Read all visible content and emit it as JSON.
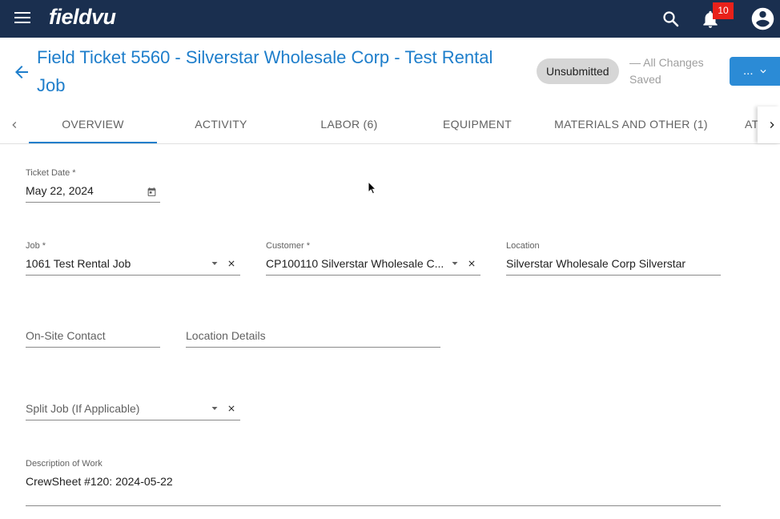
{
  "topbar": {
    "brand": "fieldvu",
    "notification_count": "10",
    "icons": [
      "menu-icon",
      "search-icon",
      "bell-icon",
      "account-circle-icon"
    ],
    "background_color": "#1a2f4f",
    "badge_color": "#e8211a"
  },
  "header": {
    "title": "Field Ticket 5560 - Silverstar Wholesale Corp - Test Rental Job",
    "status": "Unsubmitted",
    "save_state": "— All Changes Saved",
    "more_label": "...",
    "accent_color": "#1e7ecb"
  },
  "tabs": [
    {
      "label": "OVERVIEW",
      "active": true
    },
    {
      "label": "ACTIVITY",
      "active": false
    },
    {
      "label": "LABOR (6)",
      "active": false
    },
    {
      "label": "EQUIPMENT",
      "active": false
    },
    {
      "label": "MATERIALS AND OTHER (1)",
      "active": false
    },
    {
      "label": "AT",
      "active": false
    }
  ],
  "form": {
    "ticket_date": {
      "label": "Ticket Date *",
      "value": "May 22, 2024"
    },
    "job": {
      "label": "Job *",
      "value": "1061 Test Rental Job"
    },
    "customer": {
      "label": "Customer *",
      "value": "CP100110 Silverstar Wholesale C..."
    },
    "location": {
      "label": "Location",
      "value": "Silverstar Wholesale Corp Silverstar"
    },
    "onsite_contact": {
      "placeholder": "On-Site Contact"
    },
    "location_details": {
      "placeholder": "Location Details"
    },
    "split_job": {
      "placeholder": "Split Job (If Applicable)"
    },
    "description": {
      "label": "Description of Work",
      "value": "CrewSheet #120: 2024-05-22"
    }
  }
}
